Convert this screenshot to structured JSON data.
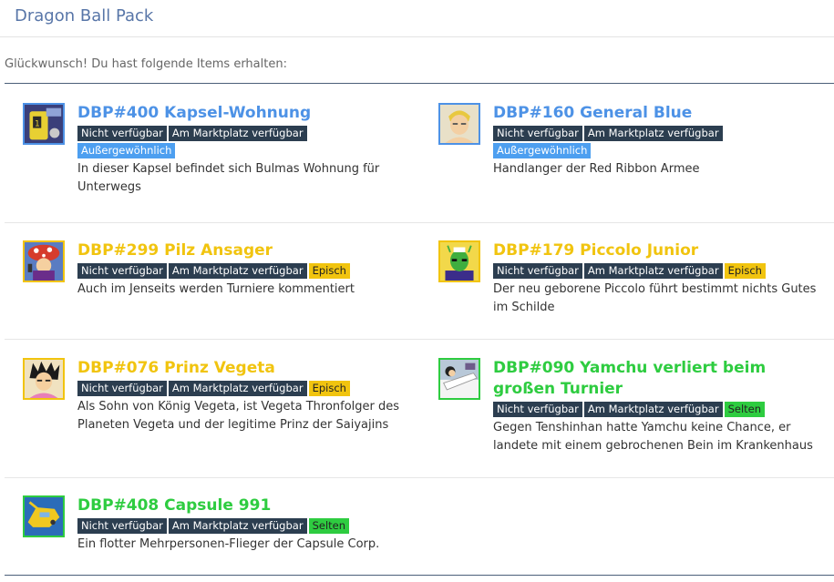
{
  "header": {
    "title": "Dragon Ball Pack"
  },
  "congrats": "Glückwunsch! Du hast folgende Items erhalten:",
  "colors": {
    "blue": "#4d92e6",
    "gold": "#f1c40f",
    "green": "#2ecc40",
    "dark_badge": "#2c3e50"
  },
  "badges": {
    "unavailable": "Nicht verfügbar",
    "market": "Am Marktplatz verfügbar"
  },
  "items": [
    {
      "name": "DBP#400 Kapsel-Wohnung",
      "rarity": "Außergewöhnlich",
      "rarity_class": "exceptional",
      "color": "#4d92e6",
      "icon": "capsule-apartment-icon",
      "description": "In dieser Kapsel befindet sich Bulmas Wohnung für Unterwegs"
    },
    {
      "name": "DBP#160 General Blue",
      "rarity": "Außergewöhnlich",
      "rarity_class": "exceptional",
      "color": "#4d92e6",
      "icon": "general-blue-icon",
      "description": "Handlanger der Red Ribbon Armee"
    },
    {
      "name": "DBP#299 Pilz Ansager",
      "rarity": "Episch",
      "rarity_class": "epic",
      "color": "#f1c40f",
      "icon": "mushroom-announcer-icon",
      "description": "Auch im Jenseits werden Turniere kommentiert"
    },
    {
      "name": "DBP#179 Piccolo Junior",
      "rarity": "Episch",
      "rarity_class": "epic",
      "color": "#f1c40f",
      "icon": "piccolo-junior-icon",
      "description": "Der neu geborene Piccolo führt bestimmt nichts Gutes im Schilde"
    },
    {
      "name": "DBP#076 Prinz Vegeta",
      "rarity": "Episch",
      "rarity_class": "epic",
      "color": "#f1c40f",
      "icon": "prince-vegeta-icon",
      "description": "Als Sohn von König Vegeta, ist Vegeta Thronfolger des Planeten Vegeta und der legitime Prinz der Saiyajins"
    },
    {
      "name": "DBP#090 Yamchu verliert beim großen Turnier",
      "rarity": "Selten",
      "rarity_class": "rare",
      "color": "#2ecc40",
      "icon": "yamchu-hospital-icon",
      "description": "Gegen Tenshinhan hatte Yamchu keine Chance, er landete mit einem gebrochenen Bein im Krankenhaus"
    },
    {
      "name": "DBP#408 Capsule 991",
      "rarity": "Selten",
      "rarity_class": "rare",
      "color": "#2ecc40",
      "icon": "capsule-991-aircraft-icon",
      "description": "Ein flotter Mehrpersonen-Flieger der Capsule Corp."
    }
  ]
}
